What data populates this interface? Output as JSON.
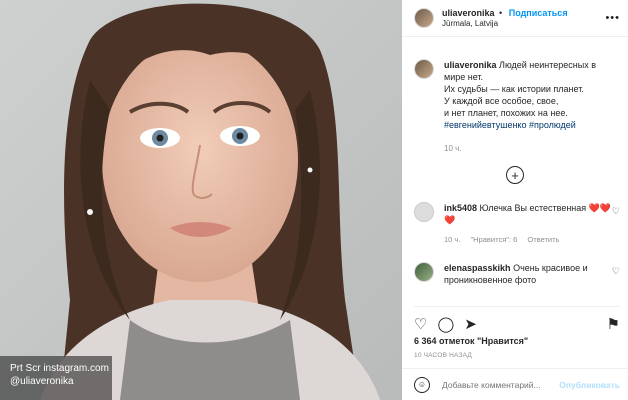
{
  "post": {
    "username": "uliaveronika",
    "follow_label": "Подписаться",
    "separator": "•",
    "location": "Jūrmala, Latvija",
    "more_icon": "more-horizontal-icon"
  },
  "caption": {
    "username": "uliaveronika",
    "line1": "Людей неинтересных в мире нет.",
    "line2": "Их судьбы — как истории планет.",
    "line3": "У каждой все особое, свое,",
    "line4": "и нет планет, похожих на нее.",
    "hashtags": "#евгенийевтушенко #пролюдей",
    "time": "10 ч."
  },
  "load_more_icon": "plus-circle-icon",
  "comments": [
    {
      "username": "ink5408",
      "text": "Юлечка Вы естественная",
      "emoji": "❤️❤️❤️",
      "time": "10 ч.",
      "likes": "\"Нравится\": 6",
      "reply": "Ответить"
    },
    {
      "username": "elenaspasskikh",
      "text": "Очень красивое и проникновенное фото"
    }
  ],
  "likes_text": "6 364 отметок \"Нравится\"",
  "posted_ago": "10 ЧАСОВ НАЗАД",
  "add_comment": {
    "placeholder": "Добавьте комментарий...",
    "publish_label": "Опубликовать"
  },
  "photo_credit": {
    "line1": "Prt Scr instagram.com",
    "line2": "@uliaveronika"
  },
  "colors": {
    "link": "#0095f6",
    "hashtag": "#00376b",
    "heart": "#e0202e",
    "muted": "#8e8e8e"
  }
}
